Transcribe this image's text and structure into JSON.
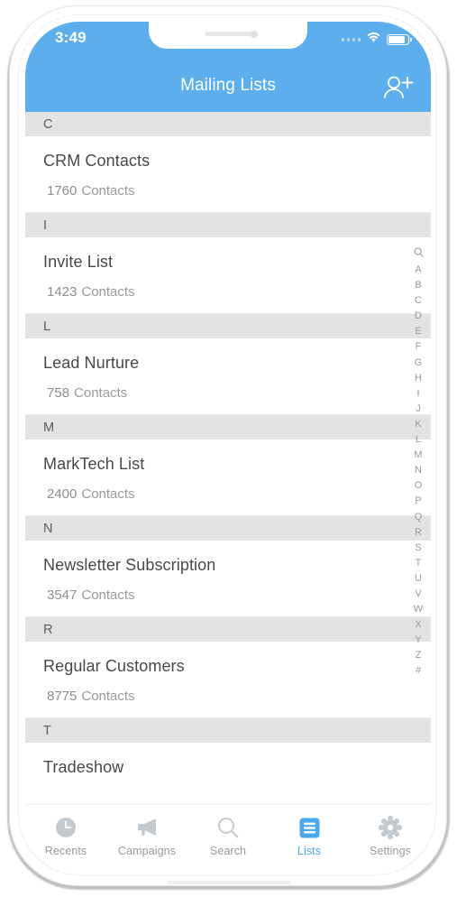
{
  "status_bar": {
    "time": "3:49",
    "signal_icon": "signal-dots-icon",
    "wifi_icon": "wifi-icon",
    "battery_icon": "battery-icon"
  },
  "nav": {
    "title": "Mailing Lists",
    "action_icon": "add-contact-icon"
  },
  "theme": {
    "accent": "#5caeec",
    "section_bg": "#e3e3e3",
    "title_color": "#484848",
    "subtitle_color": "#8e8e8e",
    "index_color": "#9b9b9b"
  },
  "list": {
    "contacts_unit": "Contacts",
    "sections": [
      {
        "letter": "C",
        "items": [
          {
            "name": "CRM Contacts",
            "count": "1760",
            "unit": "Contacts"
          }
        ]
      },
      {
        "letter": "I",
        "items": [
          {
            "name": "Invite List",
            "count": "1423",
            "unit": "Contacts"
          }
        ]
      },
      {
        "letter": "L",
        "items": [
          {
            "name": "Lead Nurture",
            "count": "758",
            "unit": "Contacts"
          }
        ]
      },
      {
        "letter": "M",
        "items": [
          {
            "name": "MarkTech List",
            "count": "2400",
            "unit": "Contacts"
          }
        ]
      },
      {
        "letter": "N",
        "items": [
          {
            "name": "Newsletter Subscription",
            "count": "3547",
            "unit": "Contacts"
          }
        ]
      },
      {
        "letter": "R",
        "items": [
          {
            "name": "Regular Customers",
            "count": "8775",
            "unit": "Contacts"
          }
        ]
      },
      {
        "letter": "T",
        "items": [
          {
            "name": "Tradeshow",
            "count": "",
            "unit": ""
          }
        ]
      }
    ]
  },
  "alpha_index": {
    "search_icon": "search-icon",
    "letters": [
      "A",
      "B",
      "C",
      "D",
      "E",
      "F",
      "G",
      "H",
      "I",
      "J",
      "K",
      "L",
      "M",
      "N",
      "O",
      "P",
      "Q",
      "R",
      "S",
      "T",
      "U",
      "V",
      "W",
      "X",
      "Y",
      "Z",
      "#"
    ]
  },
  "tabbar": {
    "active": "Lists",
    "tabs": [
      {
        "label": "Recents",
        "icon": "clock-icon"
      },
      {
        "label": "Campaigns",
        "icon": "megaphone-icon"
      },
      {
        "label": "Search",
        "icon": "search-icon"
      },
      {
        "label": "Lists",
        "icon": "list-icon"
      },
      {
        "label": "Settings",
        "icon": "gear-icon"
      }
    ]
  }
}
